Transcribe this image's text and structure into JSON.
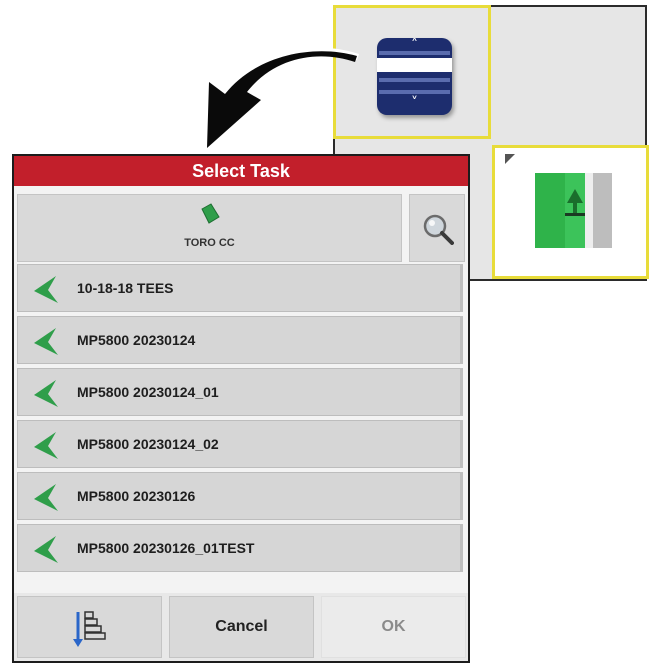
{
  "dialog": {
    "title": "Select Task",
    "farm_name": "TORO CC",
    "tasks": [
      {
        "label": "10-18-18 TEES"
      },
      {
        "label": "MP5800 20230124"
      },
      {
        "label": "MP5800 20230124_01"
      },
      {
        "label": "MP5800 20230124_02"
      },
      {
        "label": "MP5800 20230126"
      },
      {
        "label": "MP5800 20230126_01TEST"
      }
    ],
    "buttons": {
      "cancel": "Cancel",
      "ok": "OK"
    }
  },
  "icons": {
    "farm": "farm-field-icon",
    "search": "magnifier-icon",
    "task": "green-leaf-icon",
    "sort": "sort-list-icon",
    "scroll": "scroll-widget-icon",
    "guide": "guidance-lane-icon"
  },
  "colors": {
    "title_bar": "#c21f2b",
    "highlight": "#e8dc3a",
    "leaf": "#2f9e4a",
    "scroll_widget": "#1d2d6e"
  }
}
